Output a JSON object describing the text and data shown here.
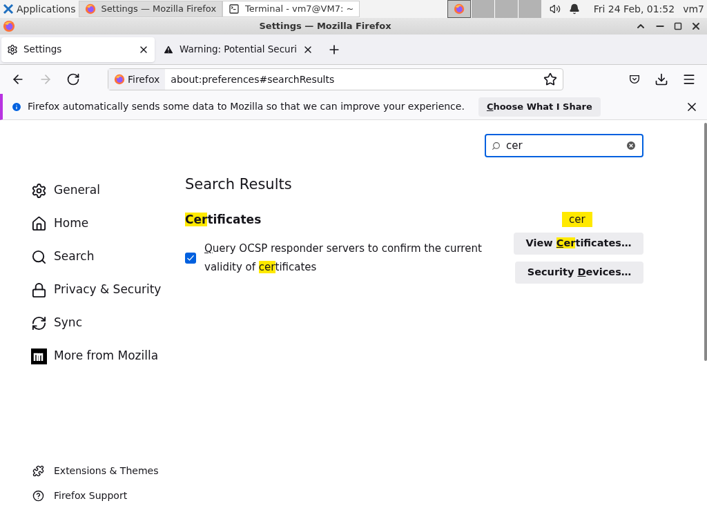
{
  "taskbar": {
    "menu": "Applications",
    "windows": [
      {
        "title": "Settings — Mozilla Firefox",
        "kind": "browser",
        "selected": true
      },
      {
        "title": "Terminal - vm7@VM7: ~",
        "kind": "terminal",
        "selected": false
      }
    ],
    "clock": "Fri 24 Feb, 01:52",
    "user": "vm7"
  },
  "window": {
    "title": "Settings — Mozilla Firefox"
  },
  "tabs": [
    {
      "label": "Settings",
      "kind": "settings",
      "selected": true
    },
    {
      "label": "Warning: Potential Securi",
      "kind": "warning",
      "selected": false
    }
  ],
  "address_bar": {
    "identity": "Firefox",
    "url": "about:preferences#searchResults"
  },
  "notification": {
    "message": "Firefox automatically sends some data to Mozilla so that we can improve your experience.",
    "button": [
      {
        "t": "C",
        "u": true
      },
      {
        "t": "hoose What I Share",
        "u": false
      }
    ]
  },
  "search": {
    "value": "cer"
  },
  "sidebar": {
    "items": [
      {
        "label": "General",
        "kind": "gear"
      },
      {
        "label": "Home",
        "kind": "home"
      },
      {
        "label": "Search",
        "kind": "search"
      },
      {
        "label": "Privacy & Security",
        "kind": "lock"
      },
      {
        "label": "Sync",
        "kind": "sync"
      },
      {
        "label": "More from Mozilla",
        "kind": "mozilla"
      }
    ],
    "footer": [
      {
        "label": "Extensions & Themes",
        "kind": "puzzle"
      },
      {
        "label": "Firefox Support",
        "kind": "help"
      }
    ]
  },
  "content": {
    "heading": "Search Results",
    "section_title": [
      {
        "t": "Cer",
        "hl": true,
        "u": false
      },
      {
        "t": "tificates",
        "hl": false,
        "u": false
      }
    ],
    "checkbox": {
      "checked": true,
      "label": [
        {
          "t": "Q",
          "hl": false,
          "u": true
        },
        {
          "t": "uery OCSP responder servers to confirm the current validity of ",
          "hl": false,
          "u": false
        },
        {
          "t": "cer",
          "hl": true,
          "u": false
        },
        {
          "t": "tificates",
          "hl": false,
          "u": false
        }
      ]
    },
    "tooltip": "cer",
    "buttons": [
      [
        {
          "t": "View ",
          "hl": false,
          "u": false
        },
        {
          "t": "C",
          "hl": true,
          "u": true
        },
        {
          "t": "er",
          "hl": true,
          "u": false
        },
        {
          "t": "tificates…",
          "hl": false,
          "u": false
        }
      ],
      [
        {
          "t": "Security ",
          "hl": false,
          "u": false
        },
        {
          "t": "D",
          "hl": false,
          "u": true
        },
        {
          "t": "evices…",
          "hl": false,
          "u": false
        }
      ]
    ]
  }
}
